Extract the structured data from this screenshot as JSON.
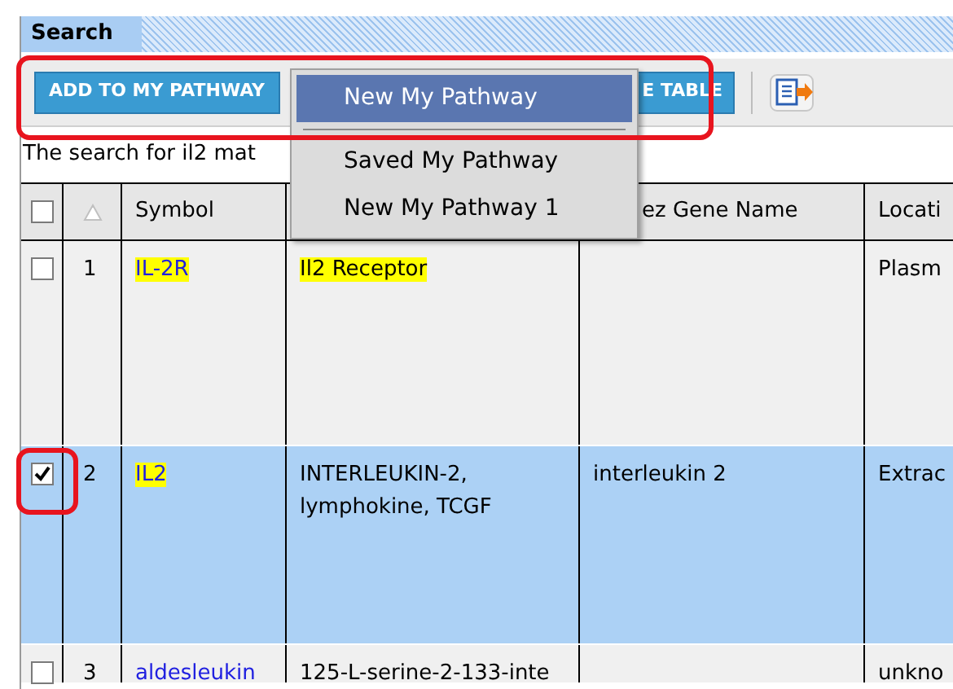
{
  "panel": {
    "title": "Search"
  },
  "toolbar": {
    "buttons": [
      {
        "label": "ADD TO MY PATHWAY"
      },
      {
        "label": "E TABLE"
      }
    ]
  },
  "dropdown": {
    "items": [
      {
        "label": "New My Pathway",
        "selected": true
      },
      {
        "label": "Saved My Pathway",
        "selected": false
      },
      {
        "label": "New My Pathway 1",
        "selected": false
      }
    ]
  },
  "message": "The search for il2 mat",
  "table": {
    "header": {
      "checked": false,
      "symbol": "Symbol",
      "column_5": "ez Gene Name",
      "column_6": "Locati"
    },
    "rows": [
      {
        "checked": false,
        "selected": false,
        "number": "1",
        "symbol": "IL-2R",
        "symbol_highlighted": true,
        "synonyms": "Il2 Receptor",
        "synonyms_highlighted": true,
        "location": "Plasm"
      },
      {
        "checked": true,
        "selected": true,
        "number": "2",
        "symbol": "IL2",
        "symbol_highlighted": true,
        "synonyms": "INTERLEUKIN-2, lymphokine, TCGF",
        "synonyms_highlighted": false,
        "entrez_gene_name": "interleukin 2",
        "location": "Extrac"
      },
      {
        "checked": false,
        "selected": false,
        "number": "3",
        "symbol": "aldesleukin",
        "symbol_highlighted": false,
        "synonyms": "125-L-serine-2-133-inte",
        "synonyms_highlighted": false,
        "location": "unkno"
      }
    ]
  },
  "highlight_frames": {
    "toolbar": true,
    "row_checkbox": true
  }
}
